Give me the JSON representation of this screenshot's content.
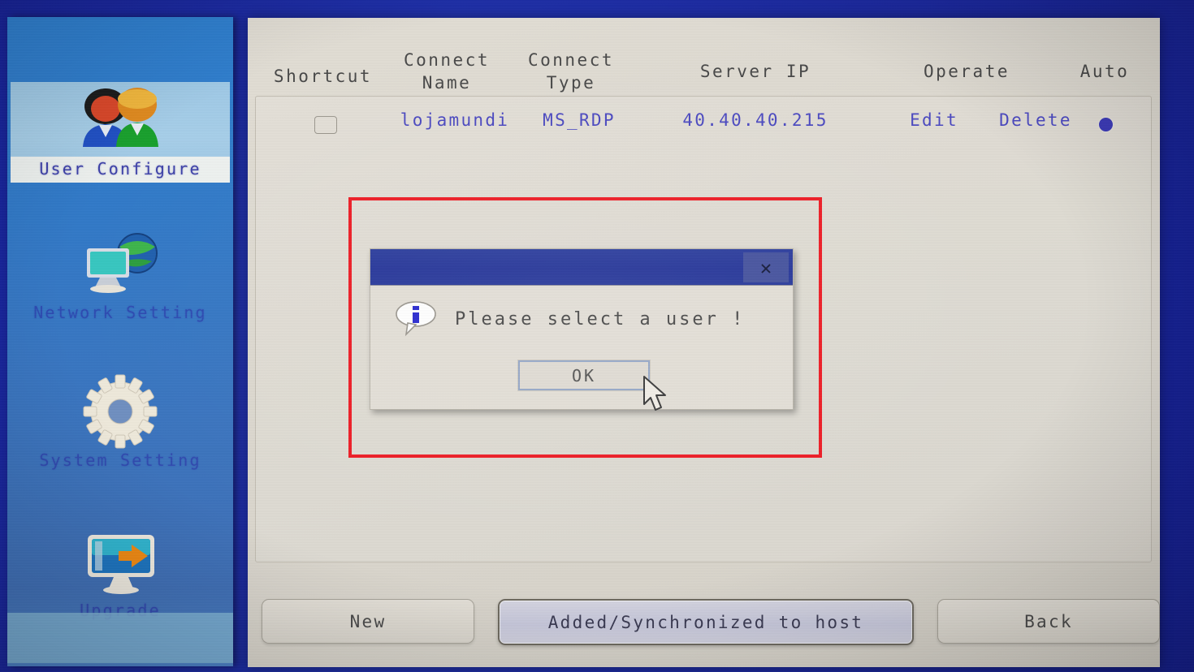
{
  "theme": {
    "desktop_bg": "#1b2a9e",
    "sidebar_bg": "#2f7fd0",
    "panel_bg": "#dedad2",
    "link_blue": "#4a48c0",
    "dialog_title_blue": "#27379a",
    "annotation_red": "#ee1c25"
  },
  "sidebar": {
    "items": [
      {
        "label": "User Configure",
        "icon": "two-users-icon",
        "selected": true
      },
      {
        "label": "Network Setting",
        "icon": "computer-globe-icon",
        "selected": false
      },
      {
        "label": "System Setting",
        "icon": "gear-icon",
        "selected": false
      },
      {
        "label": "Upgrade",
        "icon": "monitor-arrow-icon",
        "selected": false
      }
    ]
  },
  "table": {
    "columns": [
      "Shortcut",
      "Connect\nName",
      "Connect\nType",
      "Server IP",
      "Operate",
      "Auto"
    ],
    "column_labels": {
      "shortcut": "Shortcut",
      "connect_name_l1": "Connect",
      "connect_name_l2": "Name",
      "connect_type_l1": "Connect",
      "connect_type_l2": "Type",
      "server_ip": "Server IP",
      "operate": "Operate",
      "auto": "Auto"
    },
    "rows": [
      {
        "shortcut_checked": false,
        "connect_name": "lojamundi",
        "connect_type": "MS_RDP",
        "server_ip": "40.40.40.215",
        "operate_edit": "Edit",
        "operate_delete": "Delete",
        "auto_selected": true
      }
    ]
  },
  "buttons": {
    "new": "New",
    "sync": "Added/Synchronized to host",
    "back": "Back",
    "focused": "sync"
  },
  "dialog": {
    "title": "",
    "close_icon": "close-icon",
    "info_icon": "info-bubble-icon",
    "message": "Please select a user !",
    "ok_label": "OK"
  }
}
